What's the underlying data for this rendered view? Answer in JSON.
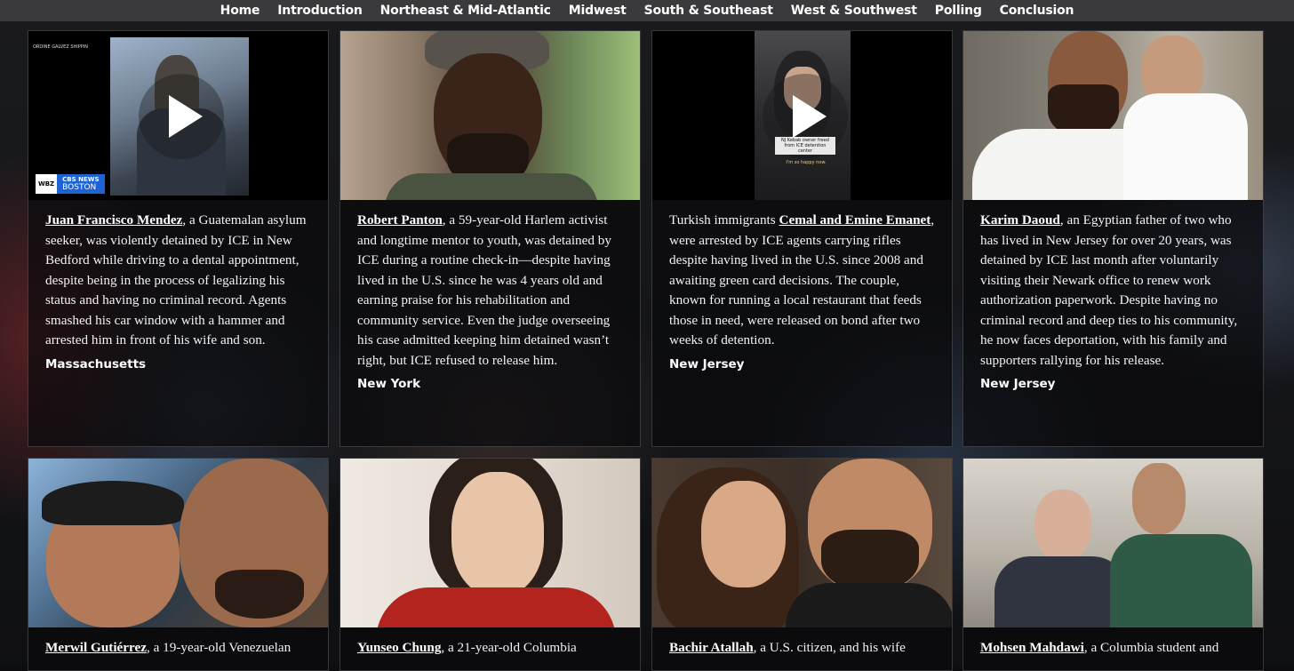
{
  "nav": {
    "items": [
      "Home",
      "Introduction",
      "Northeast & Mid-Atlantic",
      "Midwest",
      "South & Southeast",
      "West & Southwest",
      "Polling",
      "Conclusion"
    ]
  },
  "cards": [
    {
      "name": "Juan Francisco Mendez",
      "text_before": "",
      "text_after": ", a Guatemalan asylum seeker, was violently detained by ICE in New Bedford while driving to a dental appointment, despite being in the process of legalizing his status and having no criminal record. Agents smashed his car window with a hammer and arrested him in front of his wife and son.",
      "state": "Massachusetts",
      "video": {
        "channel_logo": "WBZ",
        "network": "CBS NEWS",
        "station": "BOSTON",
        "caption": "ORDINE GALVEZ SHIPPIN"
      }
    },
    {
      "name": "Robert Panton",
      "text_before": "",
      "text_after": ", a 59-year-old Harlem activist and longtime mentor to youth, was detained by ICE during a routine check-in—despite having lived in the U.S. since he was 4 years old and earning praise for his rehabilitation and community service. Even the judge overseeing his case admitted keeping him detained wasn’t right, but ICE refused to release him.",
      "state": "New York"
    },
    {
      "name": "Cemal and Emine Emanet",
      "text_before": "Turkish immigrants ",
      "text_after": ", were arrested by ICE agents carrying rifles despite having lived in the U.S. since 2008 and awaiting green card decisions. The couple, known for running a local restaurant that feeds those in need, were released on bond after two weeks of detention.",
      "state": "New Jersey",
      "video": {
        "caption_1": "NJ Kebab owner freed from ICE detention center",
        "caption_2": "I'm so happy now."
      }
    },
    {
      "name": "Karim Daoud",
      "text_before": "",
      "text_after": ", an Egyptian father of two who has lived in New Jersey for over 20 years, was detained by ICE last month after voluntarily visiting their Newark office to renew work authorization paperwork. Despite having no criminal record and deep ties to his community, he now faces deportation, with his family and supporters rallying for his release.",
      "state": "New Jersey"
    },
    {
      "name": "Merwil Gutiérrez",
      "text_before": "",
      "text_after": ", a 19-year-old Venezuelan",
      "state": ""
    },
    {
      "name": "Yunseo Chung",
      "text_before": "",
      "text_after": ", a 21-year-old Columbia",
      "state": ""
    },
    {
      "name": "Bachir Atallah",
      "text_before": "",
      "text_after": ", a U.S. citizen, and his wife",
      "state": ""
    },
    {
      "name": "Mohsen Mahdawi",
      "text_before": "",
      "text_after": ", a Columbia student and",
      "state": ""
    }
  ],
  "colors": {
    "nav_bg": "#3a3a3c",
    "card_bg": "#0a0a0c",
    "video_badge": "#1e63d6",
    "caption_yellow": "#f2d14c"
  }
}
